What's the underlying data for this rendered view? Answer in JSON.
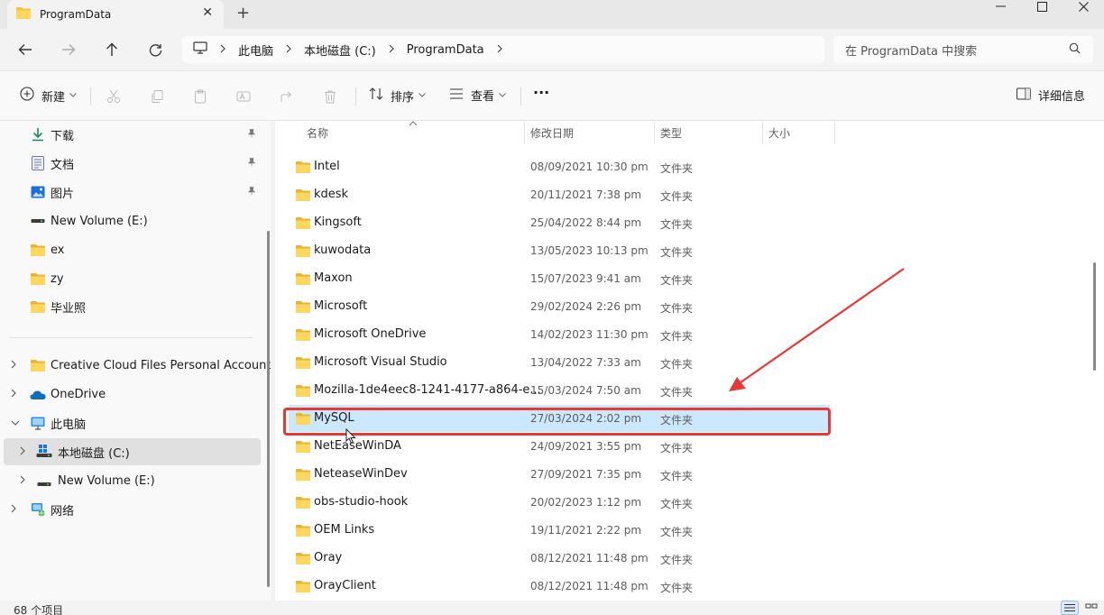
{
  "tab": {
    "title": "ProgramData",
    "close": "✕",
    "new_tab": "+"
  },
  "window": {
    "minimize": "—",
    "maximize": "☐",
    "close": "✕"
  },
  "breadcrumb": [
    "此电脑",
    "本地磁盘 (C:)",
    "ProgramData"
  ],
  "search": {
    "placeholder": "在 ProgramData 中搜索"
  },
  "commands": {
    "new": "新建",
    "sort": "排序",
    "view": "查看",
    "more": "···",
    "details": "详细信息"
  },
  "sidebar": {
    "items": [
      {
        "label": "下载",
        "icon": "download-icon",
        "pinned": true
      },
      {
        "label": "文档",
        "icon": "document-icon",
        "pinned": true
      },
      {
        "label": "图片",
        "icon": "pictures-icon",
        "pinned": true
      },
      {
        "label": "New Volume (E:)",
        "icon": "drive-icon",
        "pinned": false
      },
      {
        "label": "ex",
        "icon": "folder-icon",
        "pinned": false
      },
      {
        "label": "zy",
        "icon": "folder-icon",
        "pinned": false
      },
      {
        "label": "毕业照",
        "icon": "folder-icon",
        "pinned": false
      }
    ],
    "tree": [
      {
        "label": "Creative Cloud Files Personal Account zy",
        "icon": "folder-icon",
        "expanded": false
      },
      {
        "label": "OneDrive",
        "icon": "onedrive-cloud-icon",
        "expanded": false
      },
      {
        "label": "此电脑",
        "icon": "computer-icon",
        "expanded": true
      },
      {
        "label": "本地磁盘 (C:)",
        "icon": "windows-drive-icon",
        "expanded": false,
        "selected": true
      },
      {
        "label": "New Volume (E:)",
        "icon": "drive-icon",
        "expanded": false
      },
      {
        "label": "网络",
        "icon": "network-icon",
        "expanded": false
      }
    ]
  },
  "columns": {
    "name": "名称",
    "modified": "修改日期",
    "type": "类型",
    "size": "大小"
  },
  "files": [
    {
      "name": "Intel",
      "modified": "08/09/2021 10:30 pm",
      "type": "文件夹"
    },
    {
      "name": "kdesk",
      "modified": "20/11/2021 7:38 pm",
      "type": "文件夹"
    },
    {
      "name": "Kingsoft",
      "modified": "25/04/2022 8:44 pm",
      "type": "文件夹"
    },
    {
      "name": "kuwodata",
      "modified": "13/05/2023 10:13 pm",
      "type": "文件夹"
    },
    {
      "name": "Maxon",
      "modified": "15/07/2023 9:41 am",
      "type": "文件夹"
    },
    {
      "name": "Microsoft",
      "modified": "29/02/2024 2:26 pm",
      "type": "文件夹"
    },
    {
      "name": "Microsoft OneDrive",
      "modified": "14/02/2023 11:30 pm",
      "type": "文件夹"
    },
    {
      "name": "Microsoft Visual Studio",
      "modified": "13/04/2022 7:33 am",
      "type": "文件夹"
    },
    {
      "name": "Mozilla-1de4eec8-1241-4177-a864-e...",
      "modified": "15/03/2024 7:50 am",
      "type": "文件夹"
    },
    {
      "name": "MySQL",
      "modified": "27/03/2024 2:02 pm",
      "type": "文件夹",
      "selected": true
    },
    {
      "name": "NetEaseWinDA",
      "modified": "24/09/2021 3:55 pm",
      "type": "文件夹"
    },
    {
      "name": "NeteaseWinDev",
      "modified": "27/09/2021 7:35 pm",
      "type": "文件夹"
    },
    {
      "name": "obs-studio-hook",
      "modified": "20/02/2023 1:12 pm",
      "type": "文件夹"
    },
    {
      "name": "OEM Links",
      "modified": "19/11/2021 2:22 pm",
      "type": "文件夹"
    },
    {
      "name": "Oray",
      "modified": "08/12/2021 11:48 pm",
      "type": "文件夹"
    },
    {
      "name": "OrayClient",
      "modified": "08/12/2021 11:48 pm",
      "type": "文件夹"
    }
  ],
  "status": {
    "item_count": "68 个项目"
  },
  "colors": {
    "accent": "#0067c0",
    "folder": "#f4c542",
    "selection": "#cce8ff",
    "annotation": "#e53935"
  }
}
